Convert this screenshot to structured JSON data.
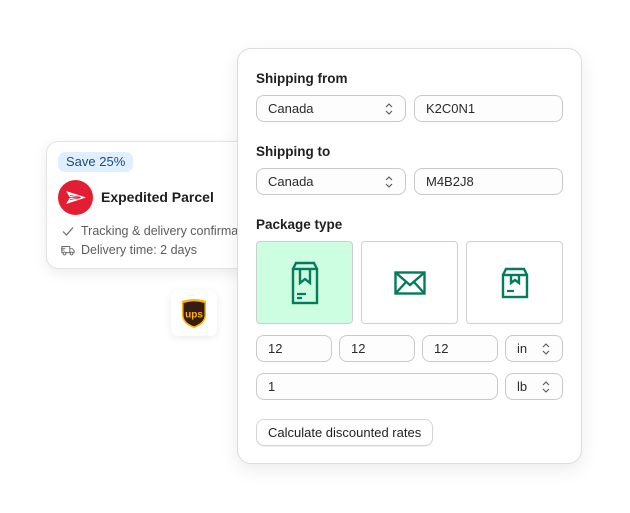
{
  "rate_card": {
    "badge": "Save 25%",
    "carrier_name": "Expedited Parcel",
    "carrier_logo": "canada-post-logo",
    "features": [
      {
        "icon": "check-icon",
        "text": "Tracking & delivery confirmation"
      },
      {
        "icon": "delivery-truck-icon",
        "text": "Delivery time: 2 days"
      }
    ]
  },
  "ups_tile": {
    "logo": "ups-logo",
    "text": "ups"
  },
  "form": {
    "shipping_from": {
      "label": "Shipping from",
      "country": "Canada",
      "postal_code": "K2C0N1"
    },
    "shipping_to": {
      "label": "Shipping to",
      "country": "Canada",
      "postal_code": "M4B2J8"
    },
    "package_type": {
      "label": "Package type",
      "options": [
        {
          "name": "box",
          "icon": "tall-box-icon",
          "selected": true
        },
        {
          "name": "envelope",
          "icon": "envelope-icon",
          "selected": false
        },
        {
          "name": "soft-package",
          "icon": "small-box-icon",
          "selected": false
        }
      ]
    },
    "dimensions": {
      "length": "12",
      "width": "12",
      "height": "12",
      "unit": "in"
    },
    "weight": {
      "value": "1",
      "unit": "lb"
    },
    "calculate_button": "Calculate discounted rates"
  },
  "colors": {
    "accent_green": "#047b5d",
    "selected_bg": "#cdfee1",
    "badge_bg": "#e0efff",
    "canada_post_red": "#e41e32",
    "ups_brown": "#351c15",
    "ups_gold": "#ffb500"
  }
}
